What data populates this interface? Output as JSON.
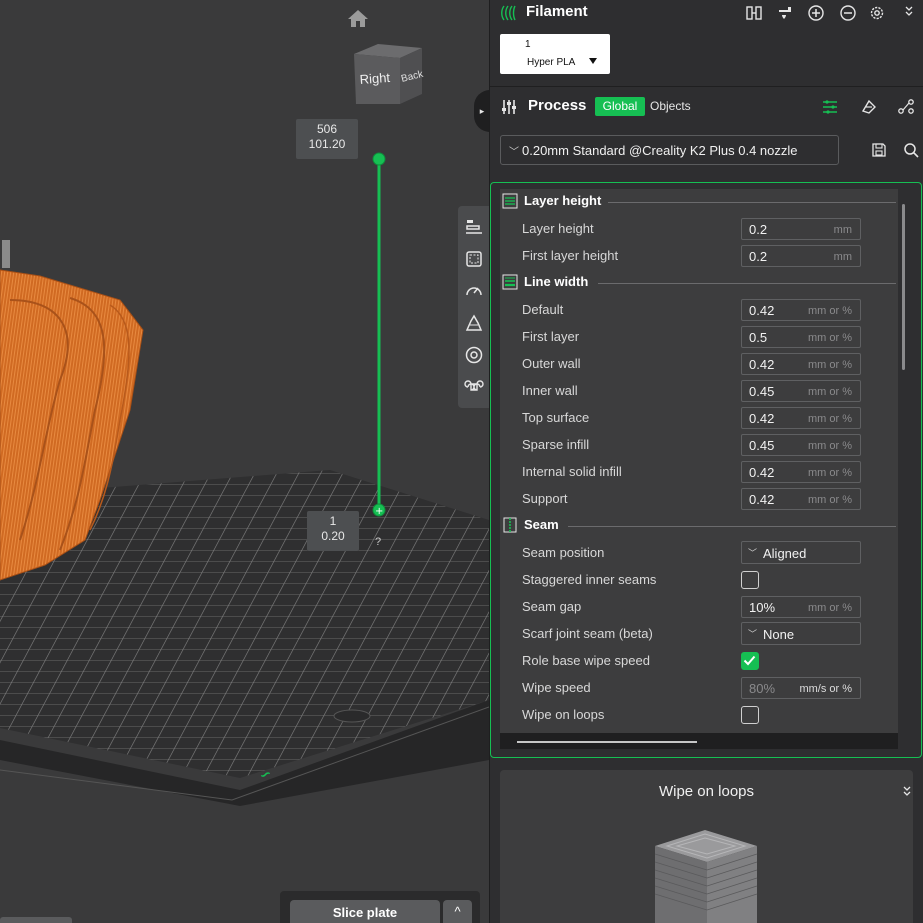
{
  "viewport": {
    "viewcube": {
      "right_label": "Right",
      "back_label": "Back"
    },
    "layer_slider": {
      "top_layer": "506",
      "top_height": "101.20",
      "bottom_layer": "1",
      "bottom_height": "0.20",
      "help": "?"
    },
    "side_tools": [
      "align-icon",
      "bounding-box-icon",
      "speed-gauge-icon",
      "wipe-tower-icon",
      "target-icon",
      "cmd-icon"
    ],
    "slice_button": "Slice plate",
    "slice_caret": "^",
    "model_color": "#d4681f",
    "accent": "#16bf53"
  },
  "panel": {
    "filament": {
      "title": "Filament",
      "slot_number": "1",
      "slot_name": "Hyper PLA"
    },
    "process": {
      "title": "Process",
      "tab_global": "Global",
      "tab_objects": "Objects",
      "preset": "0.20mm Standard @Creality K2 Plus 0.4 nozzle"
    },
    "sections": {
      "layer_height": {
        "title": "Layer height",
        "rows": [
          {
            "label": "Layer height",
            "value": "0.2",
            "unit": "mm"
          },
          {
            "label": "First layer height",
            "value": "0.2",
            "unit": "mm"
          }
        ]
      },
      "line_width": {
        "title": "Line width",
        "rows": [
          {
            "label": "Default",
            "value": "0.42",
            "unit": "mm or %"
          },
          {
            "label": "First layer",
            "value": "0.5",
            "unit": "mm or %"
          },
          {
            "label": "Outer wall",
            "value": "0.42",
            "unit": "mm or %"
          },
          {
            "label": "Inner wall",
            "value": "0.45",
            "unit": "mm or %"
          },
          {
            "label": "Top surface",
            "value": "0.42",
            "unit": "mm or %"
          },
          {
            "label": "Sparse infill",
            "value": "0.45",
            "unit": "mm or %"
          },
          {
            "label": "Internal solid infill",
            "value": "0.42",
            "unit": "mm or %"
          },
          {
            "label": "Support",
            "value": "0.42",
            "unit": "mm or %"
          }
        ]
      },
      "seam": {
        "title": "Seam",
        "seam_position": {
          "label": "Seam position",
          "value": "Aligned"
        },
        "staggered": {
          "label": "Staggered inner seams",
          "checked": false
        },
        "seam_gap": {
          "label": "Seam gap",
          "value": "10%",
          "unit": "mm or %"
        },
        "scarf": {
          "label": "Scarf joint seam (beta)",
          "value": "None"
        },
        "role_wipe": {
          "label": "Role base wipe speed",
          "checked": true
        },
        "wipe_speed": {
          "label": "Wipe speed",
          "value": "80%",
          "unit": "mm/s or %"
        },
        "wipe_loops": {
          "label": "Wipe on loops",
          "checked": false
        }
      }
    },
    "preview": {
      "title": "Wipe on loops"
    }
  }
}
